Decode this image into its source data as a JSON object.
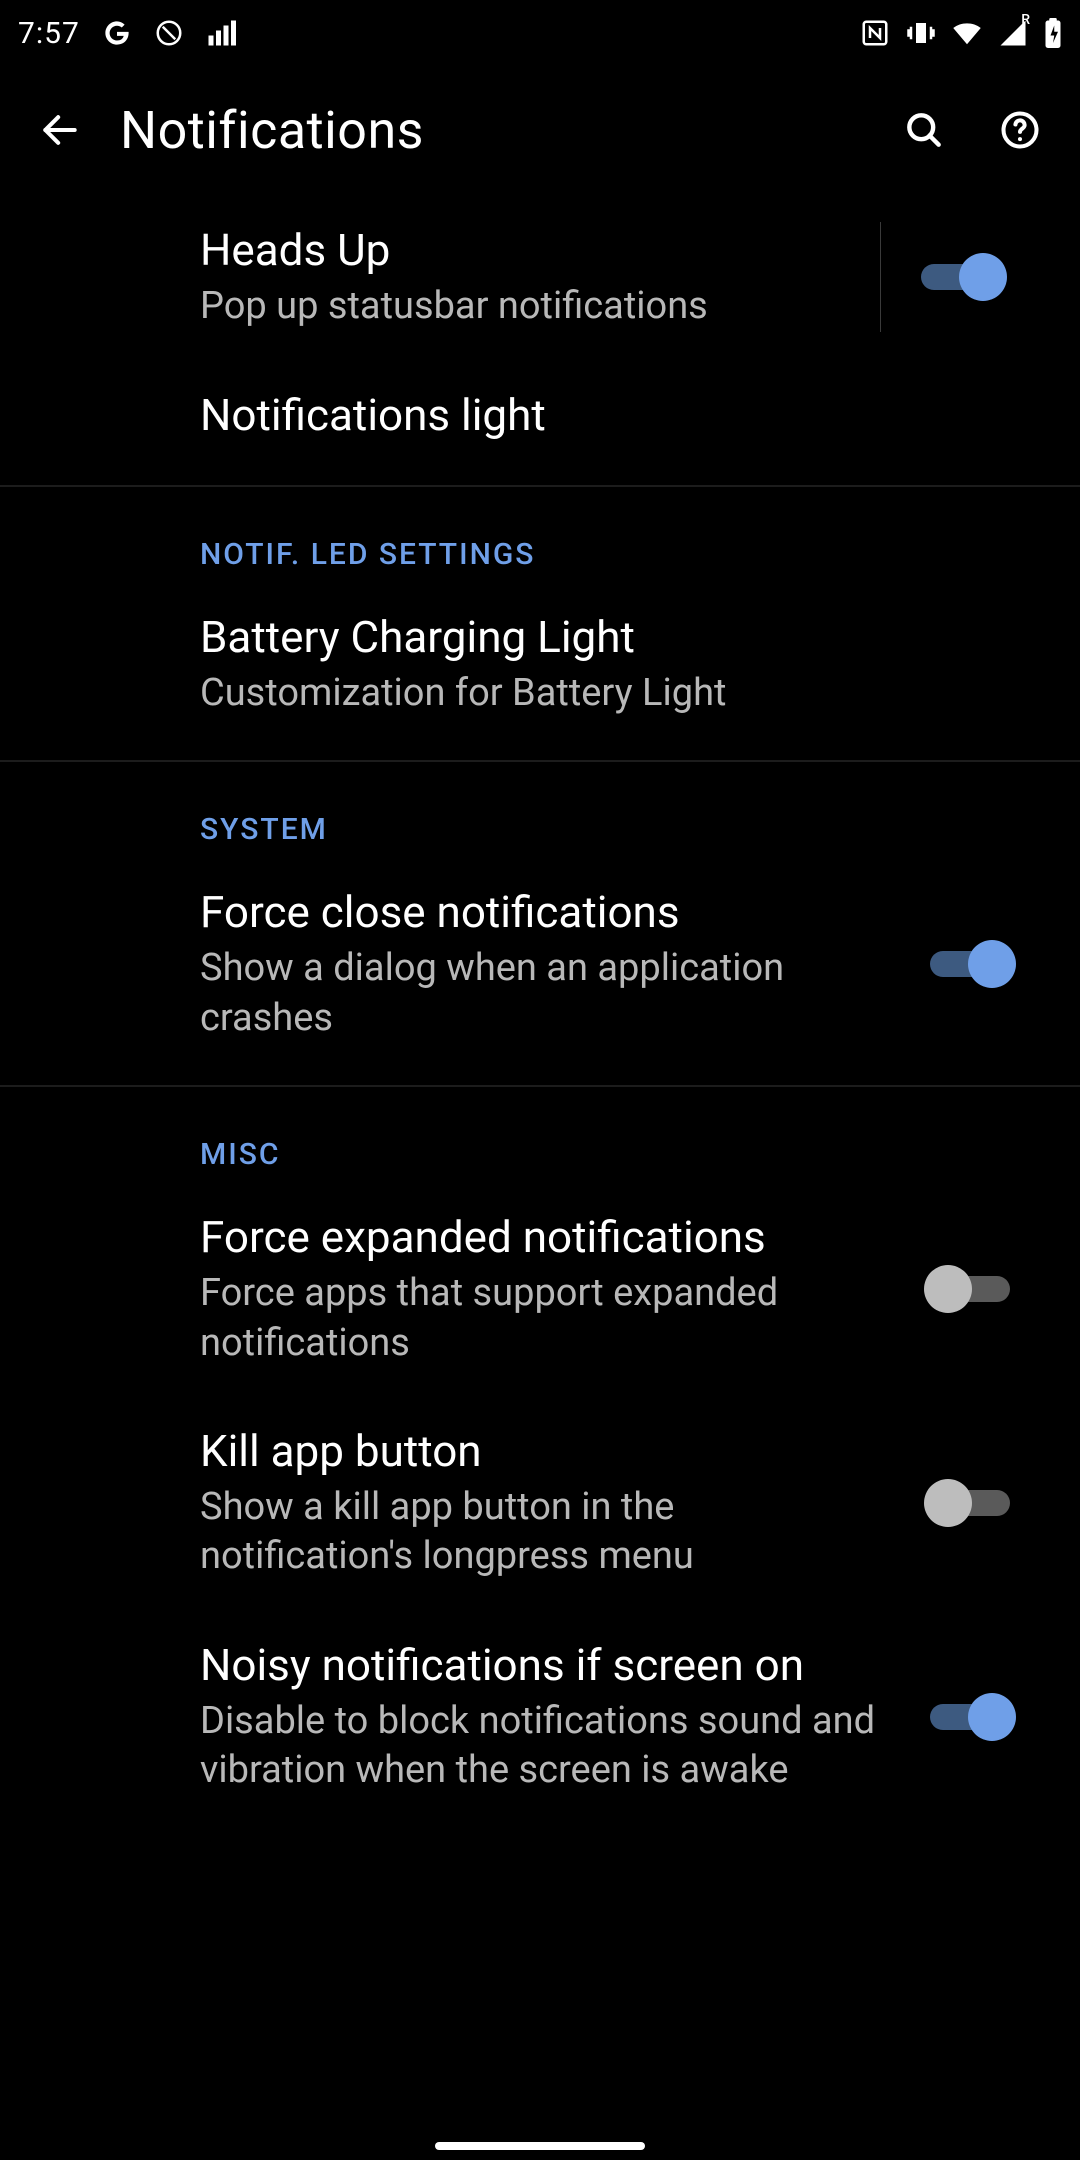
{
  "status": {
    "time": "7:57",
    "roaming": "R"
  },
  "header": {
    "title": "Notifications"
  },
  "rows": {
    "heads_up": {
      "title": "Heads Up",
      "summary": "Pop up statusbar notifications",
      "on": true
    },
    "notif_light": {
      "title": "Notifications light"
    },
    "cat_led": {
      "label": "NOTIF. LED SETTINGS"
    },
    "battery_light": {
      "title": "Battery Charging Light",
      "summary": "Customization for Battery Light"
    },
    "cat_system": {
      "label": "SYSTEM"
    },
    "force_close": {
      "title": "Force close notifications",
      "summary": "Show a dialog when an application crashes",
      "on": true
    },
    "cat_misc": {
      "label": "MISC"
    },
    "force_expand": {
      "title": "Force expanded notifications",
      "summary": "Force apps that support expanded notifications",
      "on": false
    },
    "kill_app": {
      "title": "Kill app button",
      "summary": "Show a kill app button in the notification's longpress menu",
      "on": false
    },
    "noisy": {
      "title": "Noisy notifications if screen on",
      "summary": "Disable to block notifications sound and vibration when the screen is awake",
      "on": true
    }
  }
}
